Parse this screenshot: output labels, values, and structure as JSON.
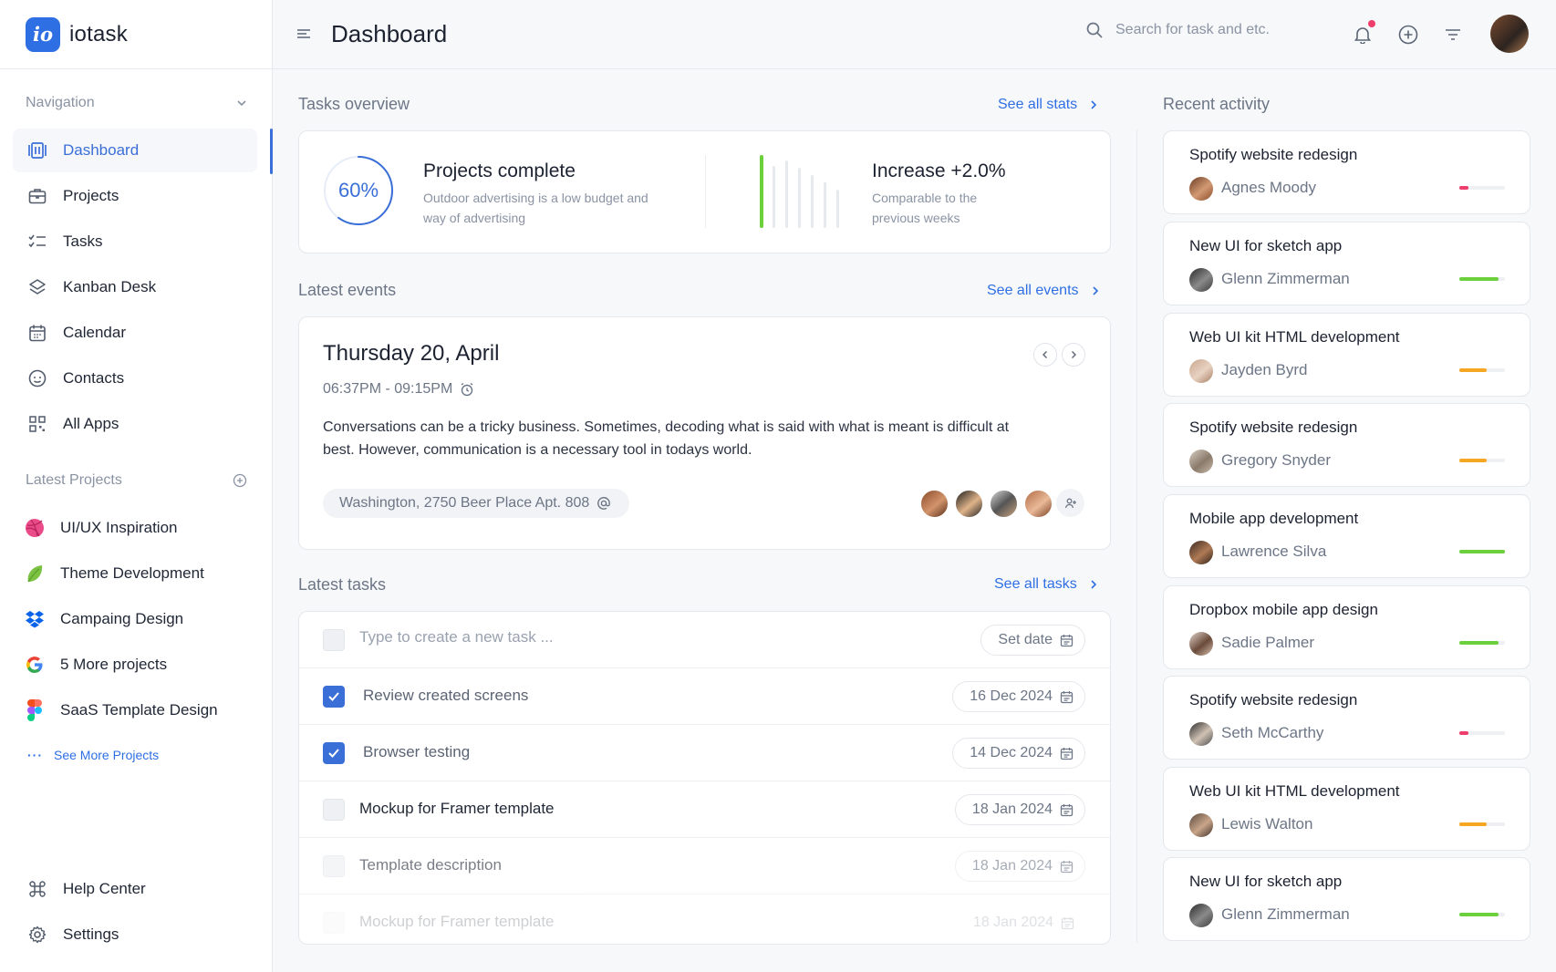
{
  "brand": {
    "logo_text": "io",
    "name": "iotask"
  },
  "header": {
    "title": "Dashboard",
    "search_placeholder": "Search for task and etc."
  },
  "sidebar": {
    "nav_heading": "Navigation",
    "nav_items": [
      {
        "label": "Dashboard",
        "icon": "dashboard-icon",
        "active": true
      },
      {
        "label": "Projects",
        "icon": "briefcase-icon"
      },
      {
        "label": "Tasks",
        "icon": "checklist-icon"
      },
      {
        "label": "Kanban Desk",
        "icon": "layers-icon"
      },
      {
        "label": "Calendar",
        "icon": "calendar-icon"
      },
      {
        "label": "Contacts",
        "icon": "contacts-icon"
      },
      {
        "label": "All Apps",
        "icon": "apps-grid-icon"
      }
    ],
    "projects_heading": "Latest Projects",
    "projects": [
      {
        "label": "UI/UX Inspiration",
        "icon": "dribbble-icon"
      },
      {
        "label": "Theme Development",
        "icon": "leaf-icon"
      },
      {
        "label": "Campaing Design",
        "icon": "dropbox-icon"
      },
      {
        "label": "5 More projects",
        "icon": "google-icon"
      },
      {
        "label": "SaaS Template Design",
        "icon": "figma-icon"
      }
    ],
    "see_more": "See More Projects",
    "footer": [
      {
        "label": "Help Center",
        "icon": "command-icon"
      },
      {
        "label": "Settings",
        "icon": "gear-icon"
      }
    ]
  },
  "overview": {
    "title": "Tasks overview",
    "link": "See all stats",
    "projects_percent": 60,
    "projects_percent_label": "60%",
    "projects_title": "Projects complete",
    "projects_desc": "Outdoor advertising is a low budget and way of advertising",
    "increase_title": "Increase +2.0%",
    "increase_desc": "Comparable to the previous weeks"
  },
  "events": {
    "title": "Latest events",
    "link": "See all events",
    "date": "Thursday 20, April",
    "time": "06:37PM - 09:15PM",
    "description": "Conversations can be a tricky business. Sometimes, decoding what is said with what is meant is difficult at best. However, communication is a necessary tool in todays world.",
    "location": "Washington, 2750 Beer Place Apt. 808"
  },
  "tasks": {
    "title": "Latest tasks",
    "link": "See all tasks",
    "new_placeholder": "Type to create a new task ...",
    "new_date_label": "Set date",
    "items": [
      {
        "label": "Review created screens",
        "date": "16 Dec 2024",
        "checked": true
      },
      {
        "label": "Browser testing",
        "date": "14 Dec 2024",
        "checked": true
      },
      {
        "label": "Mockup for Framer template",
        "date": "18 Jan 2024",
        "checked": false
      },
      {
        "label": "Template description",
        "date": "18 Jan 2024",
        "checked": false
      },
      {
        "label": "Mockup for Framer template",
        "date": "18 Jan 2024",
        "checked": false
      }
    ]
  },
  "activity": {
    "title": "Recent activity",
    "items": [
      {
        "title": "Spotify website redesign",
        "user": "Agnes Moody",
        "progress": 0.2,
        "color": "#ef3e6b"
      },
      {
        "title": "New UI for sketch app",
        "user": "Glenn Zimmerman",
        "progress": 0.85,
        "color": "#6ccf3c"
      },
      {
        "title": "Web UI kit HTML development",
        "user": "Jayden Byrd",
        "progress": 0.6,
        "color": "#f5a623"
      },
      {
        "title": "Spotify website redesign",
        "user": "Gregory Snyder",
        "progress": 0.6,
        "color": "#f5a623"
      },
      {
        "title": "Mobile app development",
        "user": "Lawrence Silva",
        "progress": 1.0,
        "color": "#6ccf3c"
      },
      {
        "title": "Dropbox mobile app design",
        "user": "Sadie Palmer",
        "progress": 0.85,
        "color": "#6ccf3c"
      },
      {
        "title": "Spotify website redesign",
        "user": "Seth McCarthy",
        "progress": 0.2,
        "color": "#ef3e6b"
      },
      {
        "title": "Web UI kit HTML development",
        "user": "Lewis Walton",
        "progress": 0.6,
        "color": "#f5a623"
      },
      {
        "title": "New UI for sketch app",
        "user": "Glenn Zimmerman",
        "progress": 0.85,
        "color": "#6ccf3c"
      }
    ]
  },
  "colors": {
    "accent": "#2f6fe4",
    "green": "#6ccf3c",
    "orange": "#f5a623",
    "pink": "#ef3e6b"
  }
}
